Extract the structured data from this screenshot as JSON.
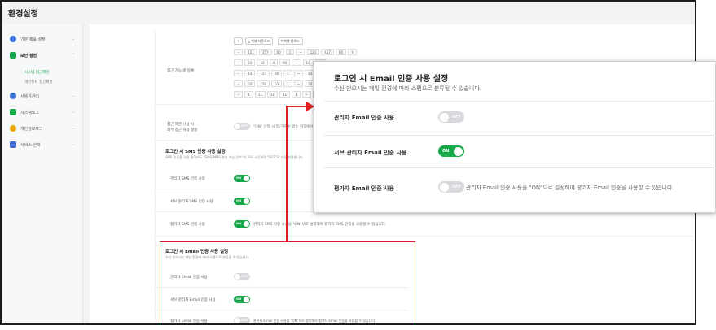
{
  "page": {
    "title": "환경설정"
  },
  "sidebar": {
    "items": [
      {
        "label": "기본 제품 설정",
        "icon": "gear-icon",
        "color": "#3b6fd6"
      },
      {
        "label": "보안 설정",
        "icon": "lock-icon",
        "color": "#17a84a"
      },
      {
        "label": "사용자관리",
        "icon": "user-icon",
        "color": "#3b6fd6"
      },
      {
        "label": "시스템로그",
        "icon": "monitor-icon",
        "color": "#17a84a"
      },
      {
        "label": "개인정보로그",
        "icon": "shield-icon",
        "color": "#f0a500"
      },
      {
        "label": "서비스 선택",
        "icon": "grid-icon",
        "color": "#3b6fd6"
      }
    ],
    "sub": [
      {
        "label": "시스템 접근제한",
        "active": true
      },
      {
        "label": "개인정보 접근제한",
        "active": false
      }
    ]
  },
  "ip_section": {
    "label": "접근 가능 IP 등록",
    "add": "+",
    "download_label": "엑셀 다운로드",
    "upload_label": "엑셀 업로드",
    "rows": [
      [
        "121",
        "157",
        "60",
        "1",
        "~",
        "121",
        "157",
        "60",
        "1"
      ],
      [
        "10",
        "10",
        "4",
        "90",
        "~",
        "10",
        "10"
      ],
      [
        "14",
        "157",
        "60",
        "1",
        "~",
        "14",
        "157"
      ],
      [
        "24",
        "126",
        "63",
        "1",
        "~",
        "24",
        "126"
      ],
      [
        "1",
        "11",
        "11",
        "11",
        "1",
        "~",
        "11",
        "11"
      ]
    ]
  },
  "outside_access": {
    "label_line1": "접근 제한 사용 시",
    "label_line2": "외부 접근 허용 설정",
    "note": "\"ON\" 선택 시 접근할 수 없는 위치에서..."
  },
  "sms_section": {
    "title": "로그인 시 SMS 인증 사용 설정",
    "desc": "SMS 인증을 사용 중이라도 \"SMS/MMS 발송 가능 건수\"가 모두 소진되면 \"OFF\"로 자동 변경됩니다.",
    "rows": [
      {
        "label": "관리자 SMS 인증 사용",
        "state": "ON"
      },
      {
        "label": "서브 관리자 SMS 인증 사용",
        "state": "ON"
      },
      {
        "label": "평가자 SMS 인증 사용",
        "state": "ON",
        "note": "관리자 SMS 인증 사용을 \"ON\"으로 설정해야 평가자 SMS 인증을 사용할 수 있습니다."
      }
    ]
  },
  "email_section": {
    "title": "로그인 시 Email 인증 사용 설정",
    "desc": "수신 받으시는 메일 환경에 따라 스팸으로 분류될 수 있습니다.",
    "rows": [
      {
        "label": "관리자 Email 인증 사용",
        "state": "OFF"
      },
      {
        "label": "서브 관리자 Email 인증 사용",
        "state": "ON"
      },
      {
        "label": "평가자 Email 인증 사용",
        "state": "OFF",
        "note": "관리자 Email 인증 사용을 \"ON\"으로 설정해야 평가자 Email 인증을 사용할 수 있습니다."
      }
    ]
  },
  "colors": {
    "accent": "#17a84a",
    "highlight": "#e02020",
    "toggle_off": "#d7d9dc"
  }
}
